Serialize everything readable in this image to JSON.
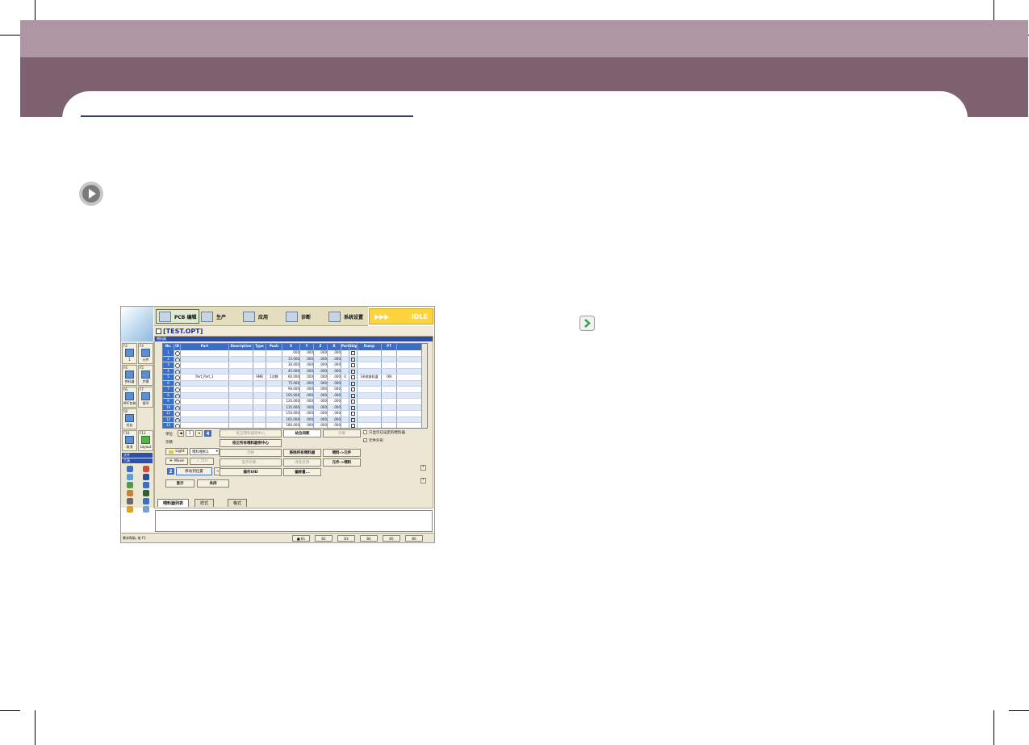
{
  "colors": {
    "header_light": "#ae97a2",
    "header_dark": "#7f6270",
    "accent_blue": "#3a6ec7",
    "idle_yellow": "#ffd33d"
  },
  "page": {
    "play_icon": "play-circle-icon",
    "go_icon": "green-arrow-icon"
  },
  "app": {
    "tabs": [
      "PCB 编辑",
      "生产",
      "应用",
      "诊断",
      "系统设置"
    ],
    "status_idle": "IDLE",
    "idle_arrows": "▶▶▶",
    "file_title": "[TEST.OPT]",
    "panel_title": "喂料器"
  },
  "sidebar": {
    "keys": [
      {
        "num": "F2",
        "label": "1"
      },
      {
        "num": "F3",
        "label": "元件"
      },
      {
        "num": "F4",
        "label": "供料器"
      },
      {
        "num": "F5",
        "label": "步骤"
      },
      {
        "num": "F6",
        "label": "ARC包装"
      },
      {
        "num": "F7",
        "label": "搜寻"
      },
      {
        "num": "F8",
        "label": "优化"
      },
      {
        "num": "F10",
        "label": "取消"
      },
      {
        "num": "F11",
        "label": "Layout"
      }
    ],
    "sel1": "文件",
    "sel2": "工具"
  },
  "grid": {
    "headers": [
      "No.",
      "ID",
      "Part",
      "Description",
      "Type",
      "Push",
      "X",
      "Y",
      "Z",
      "R",
      "PartR",
      "Skip",
      "Dump",
      "PT"
    ],
    "rows": [
      [
        "1",
        "",
        "",
        "",
        "",
        "",
        ".000",
        ".000",
        ".000",
        ".000",
        "",
        "",
        "",
        ""
      ],
      [
        "2",
        "",
        "",
        "",
        "",
        "",
        "15.000",
        ".000",
        ".000",
        ".000",
        "",
        "",
        "",
        ""
      ],
      [
        "3",
        "",
        "",
        "",
        "",
        "",
        "30.000",
        ".000",
        ".000",
        ".000",
        "",
        "",
        "",
        ""
      ],
      [
        "4",
        "",
        "",
        "",
        "",
        "",
        "45.000",
        ".000",
        ".000",
        ".000",
        "",
        "",
        "",
        ""
      ],
      [
        "5",
        "",
        "Part_Part_1",
        "",
        "SMB",
        "1次数",
        "60.000",
        ".000",
        ".000",
        ".000",
        "0",
        "",
        "1系统废料盒",
        "ON"
      ],
      [
        "6",
        "",
        "",
        "",
        "",
        "",
        "75.000",
        ".000",
        ".000",
        ".000",
        "",
        "",
        "",
        ""
      ],
      [
        "7",
        "",
        "",
        "",
        "",
        "",
        "90.000",
        ".000",
        ".000",
        ".000",
        "",
        "",
        "",
        ""
      ],
      [
        "8",
        "",
        "",
        "",
        "",
        "",
        "105.000",
        ".000",
        ".000",
        ".000",
        "",
        "",
        "",
        ""
      ],
      [
        "9",
        "",
        "",
        "",
        "",
        "",
        "120.000",
        ".000",
        ".000",
        ".000",
        "",
        "",
        "",
        ""
      ],
      [
        "10",
        "",
        "",
        "",
        "",
        "",
        "135.000",
        ".000",
        ".000",
        ".000",
        "",
        "",
        "",
        ""
      ],
      [
        "11",
        "",
        "",
        "",
        "",
        "",
        "150.000",
        ".000",
        ".000",
        ".000",
        "",
        "",
        "",
        ""
      ],
      [
        "12",
        "",
        "",
        "",
        "",
        "",
        "165.000",
        ".000",
        ".000",
        ".000",
        "",
        "",
        "",
        ""
      ],
      [
        "13",
        "",
        "",
        "",
        "",
        "",
        "180.000",
        ".000",
        ".000",
        ".000",
        "",
        "",
        "",
        ""
      ],
      [
        "14",
        "",
        "",
        "",
        "",
        "",
        "195.000",
        ".000",
        ".000",
        ".000",
        "",
        "",
        "",
        ""
      ]
    ]
  },
  "controls": {
    "step_label": "单位",
    "step_value": "1",
    "teach_label": "示教",
    "light_label": "Light",
    "camera_select": "喂料相机1",
    "move_label": "Move",
    "ctrl_label": "Ctrl",
    "move_to_pos": "移动到位置",
    "btn_correct_center": "校正喂料器到中心",
    "btn_pitch": "站位间距",
    "btn_teach": "示教",
    "btn_correct_all": "校正所有喂料器到中心",
    "btn_delete_all": "移除所有喂料器",
    "btn_feed_to_part": "喂料->元件",
    "btn_rename": "改变名称",
    "btn_part_to_feed": "元件->喂料",
    "btn_show_text": "显示示教...",
    "btn_operation_uid": "操作UID",
    "btn_offset": "偏移量...",
    "btn_display": "显示",
    "btn_close": "关闭",
    "btn_disabled_teach": "示教",
    "check_only_set": "只显示已设定的喂料器",
    "check_part_ext": "元件外形",
    "badges": [
      "2",
      "3",
      "4"
    ]
  },
  "bottom_tabs": [
    "喂料器列表",
    "样式",
    "格式"
  ],
  "status_bar": {
    "text": "需求帮助, 按 F1",
    "buttons": [
      "■ B1",
      "B2",
      "B3",
      "B4",
      "B5",
      "B6"
    ]
  }
}
